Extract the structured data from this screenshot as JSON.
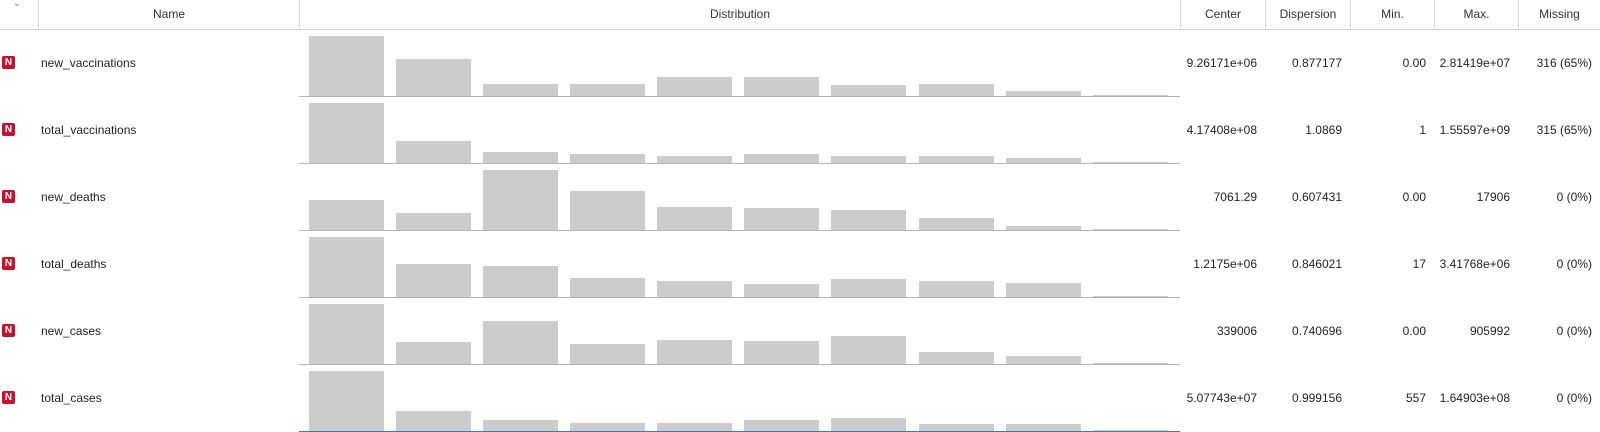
{
  "header": {
    "name": "Name",
    "distribution": "Distribution",
    "center": "Center",
    "dispersion": "Dispersion",
    "min": "Min.",
    "max": "Max.",
    "missing": "Missing",
    "sort_icon": "chevron-down-icon"
  },
  "type_badge": "N",
  "rows": [
    {
      "name": "new_vaccinations",
      "center": "9.26171e+06",
      "dispersion": "0.877177",
      "min": "0.00",
      "max": "2.81419e+07",
      "missing": "316 (65%)",
      "histogram": [
        1.0,
        0.62,
        0.2,
        0.2,
        0.32,
        0.32,
        0.19,
        0.2,
        0.09,
        0.01
      ]
    },
    {
      "name": "total_vaccinations",
      "center": "4.17408e+08",
      "dispersion": "1.0869",
      "min": "1",
      "max": "1.55597e+09",
      "missing": "315 (65%)",
      "histogram": [
        1.0,
        0.36,
        0.19,
        0.15,
        0.12,
        0.15,
        0.12,
        0.11,
        0.08,
        0.01
      ]
    },
    {
      "name": "new_deaths",
      "center": "7061.29",
      "dispersion": "0.607431",
      "min": "0.00",
      "max": "17906",
      "missing": "0 (0%)",
      "histogram": [
        0.5,
        0.28,
        1.0,
        0.65,
        0.38,
        0.36,
        0.33,
        0.2,
        0.07,
        0.0
      ]
    },
    {
      "name": "total_deaths",
      "center": "1.2175e+06",
      "dispersion": "0.846021",
      "min": "17",
      "max": "3.41768e+06",
      "missing": "0 (0%)",
      "histogram": [
        1.0,
        0.55,
        0.52,
        0.32,
        0.26,
        0.22,
        0.3,
        0.27,
        0.23,
        0.0
      ]
    },
    {
      "name": "new_cases",
      "center": "339006",
      "dispersion": "0.740696",
      "min": "0.00",
      "max": "905992",
      "missing": "0 (0%)",
      "histogram": [
        1.0,
        0.37,
        0.72,
        0.33,
        0.4,
        0.39,
        0.46,
        0.2,
        0.14,
        0.0
      ]
    },
    {
      "name": "total_cases",
      "center": "5.07743e+07",
      "dispersion": "0.999156",
      "min": "557",
      "max": "1.64903e+08",
      "missing": "0 (0%)",
      "histogram": [
        1.0,
        0.34,
        0.18,
        0.14,
        0.13,
        0.18,
        0.21,
        0.12,
        0.11,
        0.0
      ]
    }
  ],
  "colors": {
    "bar": "#cccccc",
    "badge": "#c8102e",
    "selection": "#3b78c3"
  }
}
